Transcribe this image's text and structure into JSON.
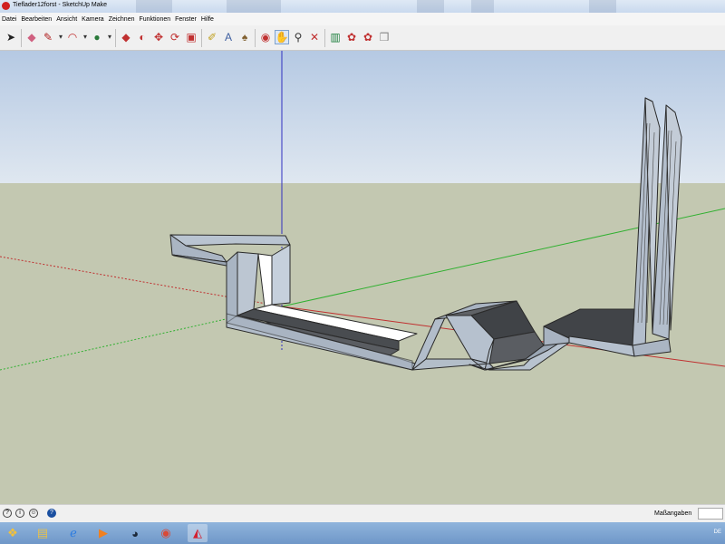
{
  "window": {
    "title": "Tieflader12forst - SketchUp Make"
  },
  "menu": [
    "Datei",
    "Bearbeiten",
    "Ansicht",
    "Kamera",
    "Zeichnen",
    "Funktionen",
    "Fenster",
    "Hilfe"
  ],
  "toolbar": {
    "tools": [
      {
        "name": "select-icon",
        "glyph": "➤",
        "color": "#222"
      },
      {
        "name": "eraser-icon",
        "glyph": "◆",
        "color": "#d06080"
      },
      {
        "name": "line-icon",
        "glyph": "✎",
        "color": "#b02020"
      },
      {
        "name": "dropdown-arrow-icon",
        "glyph": "▾",
        "color": "#333"
      },
      {
        "name": "arc-icon",
        "glyph": "◠",
        "color": "#c03030"
      },
      {
        "name": "dropdown-arrow-icon",
        "glyph": "▾",
        "color": "#333"
      },
      {
        "name": "shape-icon",
        "glyph": "●",
        "color": "#2a7a3a"
      },
      {
        "name": "dropdown-arrow-icon",
        "glyph": "▾",
        "color": "#333"
      },
      {
        "name": "push-pull-icon",
        "glyph": "◆",
        "color": "#c03030"
      },
      {
        "name": "follow-me-icon",
        "glyph": "◐",
        "color": "#c03030"
      },
      {
        "name": "move-icon",
        "glyph": "✥",
        "color": "#c03030"
      },
      {
        "name": "rotate-icon",
        "glyph": "⟳",
        "color": "#c03030"
      },
      {
        "name": "scale-icon",
        "glyph": "▣",
        "color": "#c03030"
      },
      {
        "name": "tape-measure-icon",
        "glyph": "✐",
        "color": "#c0a020"
      },
      {
        "name": "text-icon",
        "glyph": "A",
        "color": "#4060a0"
      },
      {
        "name": "paint-bucket-icon",
        "glyph": "♠",
        "color": "#806030"
      },
      {
        "name": "orbit-icon",
        "glyph": "◉",
        "color": "#c03030"
      },
      {
        "name": "pan-icon",
        "glyph": "✋",
        "color": "#333"
      },
      {
        "name": "zoom-icon",
        "glyph": "⚲",
        "color": "#333"
      },
      {
        "name": "zoom-extents-icon",
        "glyph": "✕",
        "color": "#c03030"
      },
      {
        "name": "components-icon",
        "glyph": "▥",
        "color": "#208040"
      },
      {
        "name": "warehouse-icon",
        "glyph": "✿",
        "color": "#c03030"
      },
      {
        "name": "extension-icon",
        "glyph": "✿",
        "color": "#c03030"
      },
      {
        "name": "share-model-icon",
        "glyph": "❒",
        "color": "#888"
      }
    ]
  },
  "viewport": {
    "sky_color": "#c7d7ea",
    "ground_color": "#c3c8b1",
    "model_face_color": "#adb8c6",
    "model_dark_color": "#3f4245",
    "model_light_color": "#ffffff"
  },
  "statusbar": {
    "icons": [
      "geo-location-icon",
      "credits-icon",
      "user-icon",
      "help-icon"
    ],
    "measure_label": "Maßangaben",
    "measure_value": ""
  },
  "taskbar": {
    "apps": [
      {
        "name": "start-button-icon",
        "glyph": "❖",
        "color": "#f3c13a"
      },
      {
        "name": "explorer-icon",
        "glyph": "▤",
        "color": "#e7c04d"
      },
      {
        "name": "internet-explorer-icon",
        "glyph": "ℯ",
        "color": "#2b7be0"
      },
      {
        "name": "media-player-icon",
        "glyph": "▶",
        "color": "#f08020"
      },
      {
        "name": "steam-icon",
        "glyph": "◕",
        "color": "#1b2838"
      },
      {
        "name": "chrome-icon",
        "glyph": "◉",
        "color": "#d84a38"
      },
      {
        "name": "sketchup-icon",
        "glyph": "◭",
        "color": "#d32030"
      }
    ],
    "tray_text": "DE"
  }
}
